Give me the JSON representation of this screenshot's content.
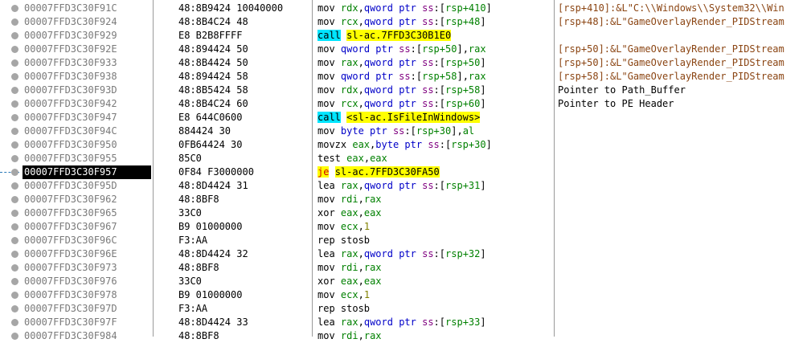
{
  "rows": [
    {
      "addr": "00007FFD3C30F91C",
      "bytes": "48:8B9424 10040000",
      "mnem": "mov",
      "kind": "mov_reg_mem",
      "reg": "rdx",
      "size": "qword",
      "seg": "ss",
      "mem": "rsp+410",
      "comment": "[rsp+410]:&L\"C:\\\\Windows\\\\System32\\\\Win",
      "comment_kind": "str"
    },
    {
      "addr": "00007FFD3C30F924",
      "bytes": "48:8B4C24 48",
      "mnem": "mov",
      "kind": "mov_reg_mem",
      "reg": "rcx",
      "size": "qword",
      "seg": "ss",
      "mem": "rsp+48",
      "comment": "[rsp+48]:&L\"GameOverlayRender_PIDStream",
      "comment_kind": "str"
    },
    {
      "addr": "00007FFD3C30F929",
      "bytes": "E8 B2B8FFFF",
      "mnem": "call",
      "kind": "call",
      "target": "sl-ac.7FFD3C30B1E0",
      "comment": "",
      "comment_kind": ""
    },
    {
      "addr": "00007FFD3C30F92E",
      "bytes": "48:894424 50",
      "mnem": "mov",
      "kind": "mov_mem_reg",
      "reg": "rax",
      "size": "qword",
      "seg": "ss",
      "mem": "rsp+50",
      "comment": "[rsp+50]:&L\"GameOverlayRender_PIDStream",
      "comment_kind": "str"
    },
    {
      "addr": "00007FFD3C30F933",
      "bytes": "48:8B4424 50",
      "mnem": "mov",
      "kind": "mov_reg_mem",
      "reg": "rax",
      "size": "qword",
      "seg": "ss",
      "mem": "rsp+50",
      "comment": "[rsp+50]:&L\"GameOverlayRender_PIDStream",
      "comment_kind": "str"
    },
    {
      "addr": "00007FFD3C30F938",
      "bytes": "48:894424 58",
      "mnem": "mov",
      "kind": "mov_mem_reg",
      "reg": "rax",
      "size": "qword",
      "seg": "ss",
      "mem": "rsp+58",
      "comment": "[rsp+58]:&L\"GameOverlayRender_PIDStream",
      "comment_kind": "str"
    },
    {
      "addr": "00007FFD3C30F93D",
      "bytes": "48:8B5424 58",
      "mnem": "mov",
      "kind": "mov_reg_mem",
      "reg": "rdx",
      "size": "qword",
      "seg": "ss",
      "mem": "rsp+58",
      "comment": "Pointer to Path_Buffer",
      "comment_kind": "plain"
    },
    {
      "addr": "00007FFD3C30F942",
      "bytes": "48:8B4C24 60",
      "mnem": "mov",
      "kind": "mov_reg_mem",
      "reg": "rcx",
      "size": "qword",
      "seg": "ss",
      "mem": "rsp+60",
      "comment": "Pointer to PE Header",
      "comment_kind": "plain"
    },
    {
      "addr": "00007FFD3C30F947",
      "bytes": "E8 644C0600",
      "mnem": "call",
      "kind": "call",
      "target": "<sl-ac.IsFileInWindows>",
      "comment": "",
      "comment_kind": ""
    },
    {
      "addr": "00007FFD3C30F94C",
      "bytes": "884424 30",
      "mnem": "mov",
      "kind": "mov_mem_reg",
      "reg": "al",
      "size": "byte",
      "seg": "ss",
      "mem": "rsp+30",
      "comment": "",
      "comment_kind": ""
    },
    {
      "addr": "00007FFD3C30F950",
      "bytes": "0FB64424 30",
      "mnem": "movzx",
      "kind": "mov_reg_mem",
      "reg": "eax",
      "size": "byte",
      "seg": "ss",
      "mem": "rsp+30",
      "comment": "",
      "comment_kind": ""
    },
    {
      "addr": "00007FFD3C30F955",
      "bytes": "85C0",
      "mnem": "test",
      "kind": "reg_reg",
      "reg": "eax",
      "reg2": "eax",
      "comment": "",
      "comment_kind": ""
    },
    {
      "addr": "00007FFD3C30F957",
      "bytes": "0F84 F3000000",
      "mnem": "je",
      "kind": "jmp",
      "target": "sl-ac.7FFD3C30FA50",
      "comment": "",
      "comment_kind": "",
      "selected": true
    },
    {
      "addr": "00007FFD3C30F95D",
      "bytes": "48:8D4424 31",
      "mnem": "lea",
      "kind": "mov_reg_mem",
      "reg": "rax",
      "size": "qword",
      "seg": "ss",
      "mem": "rsp+31",
      "comment": "",
      "comment_kind": ""
    },
    {
      "addr": "00007FFD3C30F962",
      "bytes": "48:8BF8",
      "mnem": "mov",
      "kind": "reg_reg",
      "reg": "rdi",
      "reg2": "rax",
      "comment": "",
      "comment_kind": ""
    },
    {
      "addr": "00007FFD3C30F965",
      "bytes": "33C0",
      "mnem": "xor",
      "kind": "reg_reg",
      "reg": "eax",
      "reg2": "eax",
      "comment": "",
      "comment_kind": ""
    },
    {
      "addr": "00007FFD3C30F967",
      "bytes": "B9 01000000",
      "mnem": "mov",
      "kind": "reg_imm",
      "reg": "ecx",
      "imm": "1",
      "comment": "",
      "comment_kind": ""
    },
    {
      "addr": "00007FFD3C30F96C",
      "bytes": "F3:AA",
      "mnem": "rep stosb",
      "kind": "bare",
      "comment": "",
      "comment_kind": ""
    },
    {
      "addr": "00007FFD3C30F96E",
      "bytes": "48:8D4424 32",
      "mnem": "lea",
      "kind": "mov_reg_mem",
      "reg": "rax",
      "size": "qword",
      "seg": "ss",
      "mem": "rsp+32",
      "comment": "",
      "comment_kind": ""
    },
    {
      "addr": "00007FFD3C30F973",
      "bytes": "48:8BF8",
      "mnem": "mov",
      "kind": "reg_reg",
      "reg": "rdi",
      "reg2": "rax",
      "comment": "",
      "comment_kind": ""
    },
    {
      "addr": "00007FFD3C30F976",
      "bytes": "33C0",
      "mnem": "xor",
      "kind": "reg_reg",
      "reg": "eax",
      "reg2": "eax",
      "comment": "",
      "comment_kind": ""
    },
    {
      "addr": "00007FFD3C30F978",
      "bytes": "B9 01000000",
      "mnem": "mov",
      "kind": "reg_imm",
      "reg": "ecx",
      "imm": "1",
      "comment": "",
      "comment_kind": ""
    },
    {
      "addr": "00007FFD3C30F97D",
      "bytes": "F3:AA",
      "mnem": "rep stosb",
      "kind": "bare",
      "comment": "",
      "comment_kind": ""
    },
    {
      "addr": "00007FFD3C30F97F",
      "bytes": "48:8D4424 33",
      "mnem": "lea",
      "kind": "mov_reg_mem",
      "reg": "rax",
      "size": "qword",
      "seg": "ss",
      "mem": "rsp+33",
      "comment": "",
      "comment_kind": ""
    },
    {
      "addr": "00007FFD3C30F984",
      "bytes": "48:8BF8",
      "mnem": "mov",
      "kind": "reg_reg",
      "reg": "rdi",
      "reg2": "rax",
      "comment": "",
      "comment_kind": ""
    }
  ],
  "colors": {
    "selected_row_bg": "#000000",
    "call_highlight": "#00e5ff",
    "jump_highlight": "#ffff00",
    "register": "#008000",
    "keyword": "#0000c8",
    "segment": "#800080",
    "string_comment": "#8b4513"
  }
}
